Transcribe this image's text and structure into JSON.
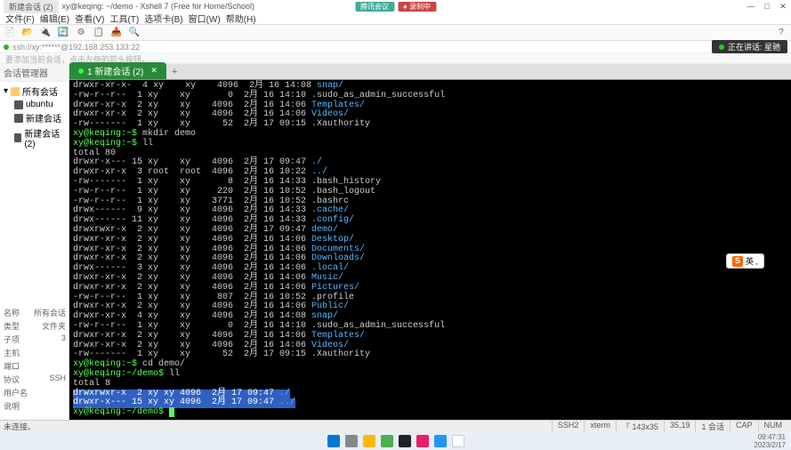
{
  "titlebar": {
    "tab": "新建会话 (2)",
    "title": "xy@keqing: ~/demo - Xshell 7 (Free for Home/School)",
    "center_app": "腾讯会议",
    "center_status": "● 录制中"
  },
  "menubar": [
    "文件(F)",
    "编辑(E)",
    "查看(V)",
    "工具(T)",
    "选项卡(B)",
    "窗口(W)",
    "帮助(H)"
  ],
  "addrbar": {
    "text": "ssh://xy:******@192.168.253.133:22",
    "status": "正在讲话: 星驰"
  },
  "hintbar": "要添加当前会话，点击左侧的箭头按钮。",
  "sidebar": {
    "title": "会话管理器",
    "root": "所有会话",
    "items": [
      "ubuntu",
      "新建会话",
      "新建会话 (2)"
    ],
    "props": [
      [
        "名称",
        "所有会话"
      ],
      [
        "类型",
        "文件夹"
      ],
      [
        "子项",
        "3"
      ],
      [
        "主机",
        ""
      ],
      [
        "端口",
        ""
      ],
      [
        "协议",
        "SSH"
      ],
      [
        "用户名",
        ""
      ],
      [
        "说明",
        ""
      ]
    ]
  },
  "tab": {
    "label": "1 新建会话 (2)",
    "plus": "+"
  },
  "lines": [
    {
      "t": "drwxr-xr-x-  4 xy    xy    4096  2月 16 14:08 ",
      "b": "snap/"
    },
    {
      "t": "-rw-r--r--  1 xy    xy       0  2月 16 14:10 .sudo_as_admin_successful"
    },
    {
      "t": "drwxr-xr-x  2 xy    xy    4096  2月 16 14:06 ",
      "b": "Templates/"
    },
    {
      "t": "drwxr-xr-x  2 xy    xy    4096  2月 16 14:06 ",
      "b": "Videos/"
    },
    {
      "t": "-rw-------  1 xy    xy      52  2月 17 09:15 .Xauthority"
    },
    {
      "p": "xy@keqing:~$ ",
      "t": "mkdir demo"
    },
    {
      "p": "xy@keqing:~$ ",
      "t": "ll"
    },
    {
      "t": "total 80"
    },
    {
      "t": "drwxr-x--- 15 xy    xy    4096  2月 17 09:47 ",
      "b": "./"
    },
    {
      "t": "drwxr-xr-x  3 root  root  4096  2月 16 10:22 ",
      "b": "../"
    },
    {
      "t": "-rw-------  1 xy    xy       8  2月 16 14:33 .bash_history"
    },
    {
      "t": "-rw-r--r--  1 xy    xy     220  2月 16 10:52 .bash_logout"
    },
    {
      "t": "-rw-r--r--  1 xy    xy    3771  2月 16 10:52 .bashrc"
    },
    {
      "t": "drwx------  9 xy    xy    4096  2月 16 14:33 ",
      "b": ".cache/"
    },
    {
      "t": "drwx------ 11 xy    xy    4096  2月 16 14:33 ",
      "b": ".config/"
    },
    {
      "t": "drwxrwxr-x  2 xy    xy    4096  2月 17 09:47 ",
      "b": "demo/"
    },
    {
      "t": "drwxr-xr-x  2 xy    xy    4096  2月 16 14:06 ",
      "b": "Desktop/"
    },
    {
      "t": "drwxr-xr-x  2 xy    xy    4096  2月 16 14:06 ",
      "b": "Documents/"
    },
    {
      "t": "drwxr-xr-x  2 xy    xy    4096  2月 16 14:06 ",
      "b": "Downloads/"
    },
    {
      "t": "drwx------  3 xy    xy    4096  2月 16 14:06 ",
      "b": ".local/"
    },
    {
      "t": "drwxr-xr-x  2 xy    xy    4096  2月 16 14:06 ",
      "b": "Music/"
    },
    {
      "t": "drwxr-xr-x  2 xy    xy    4096  2月 16 14:06 ",
      "b": "Pictures/"
    },
    {
      "t": "-rw-r--r--  1 xy    xy     807  2月 16 10:52 .profile"
    },
    {
      "t": "drwxr-xr-x  2 xy    xy    4096  2月 16 14:06 ",
      "b": "Public/"
    },
    {
      "t": "drwxr-xr-x  4 xy    xy    4096  2月 16 14:08 ",
      "b": "snap/"
    },
    {
      "t": "-rw-r--r--  1 xy    xy       0  2月 16 14:10 .sudo_as_admin_successful"
    },
    {
      "t": "drwxr-xr-x  2 xy    xy    4096  2月 16 14:06 ",
      "b": "Templates/"
    },
    {
      "t": "drwxr-xr-x  2 xy    xy    4096  2月 16 14:06 ",
      "b": "Videos/"
    },
    {
      "t": "-rw-------  1 xy    xy      52  2月 17 09:15 .Xauthority"
    },
    {
      "p": "xy@keqing:~$ ",
      "t": "cd demo/"
    },
    {
      "p": "xy@keqing:~/demo$ ",
      "t": "ll"
    },
    {
      "t": "total 8"
    },
    {
      "sel": true,
      "t": "drwxrwxr-x  2 xy xy 4096  2月 17 09:47 ",
      "b": "./"
    },
    {
      "sel": true,
      "t": "drwxr-x--- 15 xy xy 4096  2月 17 09:47 ",
      "b": "../"
    },
    {
      "p": "xy@keqing:~/demo$ ",
      "cur": true
    }
  ],
  "statusbar": {
    "left": "未连接。",
    "segs": [
      "SSH2",
      "xterm",
      "『 143x35",
      "35,19",
      "1 会话  ",
      "CAP",
      "NUM"
    ]
  },
  "taskbar": {
    "time1": "09:47:31",
    "time2": "2023/2/17"
  },
  "ime": {
    "s": "S",
    "lang": "英 ,"
  }
}
